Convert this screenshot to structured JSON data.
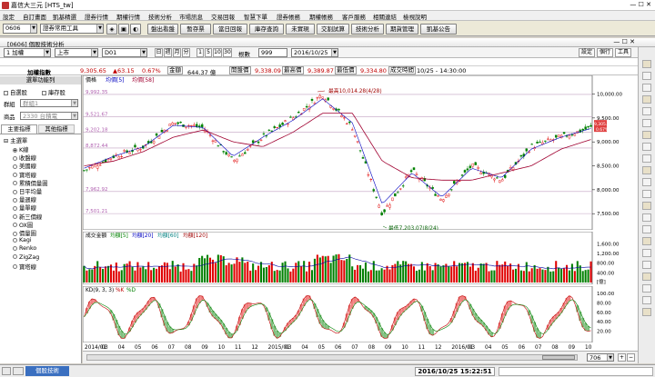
{
  "app": {
    "title": "嘉信大三元 [HTS_tw]"
  },
  "menu": [
    "設定",
    "自訂畫面",
    "凱基精選",
    "證券行情",
    "期權行情",
    "技術分析",
    "市場訊息",
    "交易回報",
    "智慧下單",
    "證券帳務",
    "期權帳務",
    "客戶服務",
    "相關連結",
    "檢視說明"
  ],
  "toolbar": {
    "code": "0606",
    "layout_select": "證券常用工具",
    "buttons": [
      "盤出看盤",
      "暫存票",
      "當日回報",
      "庫存查詢",
      "未實現",
      "交割試算",
      "技術分析",
      "期貨管理",
      "凱基公告"
    ]
  },
  "window": {
    "title": "[0606] 個股技術分析"
  },
  "controls": {
    "symbol": "1 加權",
    "market": "上市",
    "period": "D01",
    "freq_buttons": [
      "日",
      "週",
      "月",
      "分"
    ],
    "minute_buttons": [
      "1",
      "5",
      "10",
      "30"
    ],
    "count_label": "根數",
    "count": "999",
    "date": "2016/10/25",
    "right_buttons": [
      "設定",
      "個行",
      "工具"
    ]
  },
  "quote": {
    "name": "加權指數",
    "price": "9,305.65",
    "change": "▲63.15",
    "pct": "0.67%",
    "vol_label": "金額",
    "vol": "644.37 億",
    "open_label": "開盤價",
    "open": "9,338.09",
    "high_label": "最高價",
    "high": "9,389.87",
    "low_label": "最低價",
    "low": "9,334.80",
    "time_label": "成交時間",
    "time": "10/25 - 14:30:00"
  },
  "left": {
    "header": "選單功能列",
    "checks": [
      "自選股",
      "庫存股"
    ],
    "group_label": "群組",
    "group_value": "群組1",
    "product_label": "商品",
    "product_value": "2330 台積電",
    "tabs": [
      "主要指標",
      "其他指標"
    ],
    "tree_root": "主選單",
    "items": [
      "K線",
      "收盤線",
      "美國線",
      "寶塔線",
      "累積價量圖",
      "日平均量",
      "量週線",
      "量單線",
      "新三價線",
      "OX圖",
      "價量圖",
      "Kagi",
      "Renko",
      "ZigZag",
      "寶塔線"
    ]
  },
  "chart_labels": {
    "main_title": "價格",
    "ma5": "均價[5]",
    "ma58": "均價[58]",
    "high_ann": "最高10,014.28(4/28)",
    "low_ann": "最低7,203.07(8/24)",
    "vol_title": "成交金額",
    "vol_ma5": "均額[5]",
    "vol_ma20": "均額[20]",
    "vol_ma60": "均額[60]",
    "vol_ma120": "均額[120]",
    "vol_unit": "[億]",
    "kd_title": "KD(9, 3, 3)",
    "kd_k": "%K",
    "kd_d": "%D",
    "price_tag": "9,305.65",
    "pct_tag": "0.67%",
    "fib_levels": [
      "9,992.35",
      "9,521.67",
      "9,202.18",
      "8,872.44",
      "7,962.92",
      "7,501.21"
    ]
  },
  "chart_data": [
    {
      "type": "line",
      "title": "價格",
      "x": [
        "2014/01",
        "2014/03",
        "2014/05",
        "2014/07",
        "2014/09",
        "2014/11",
        "2015/01",
        "2015/03",
        "2015/05",
        "2015/07",
        "2015/09",
        "2015/11",
        "2016/01",
        "2016/03",
        "2016/05",
        "2016/07",
        "2016/09",
        "2016/10"
      ],
      "series": [
        {
          "name": "K線",
          "values": [
            8400,
            8700,
            8900,
            9400,
            9300,
            8600,
            9100,
            9500,
            10000,
            9300,
            7500,
            8400,
            7800,
            8500,
            8200,
            8900,
            9100,
            9300
          ]
        },
        {
          "name": "均價[5]",
          "values": [
            8450,
            8700,
            8900,
            9350,
            9300,
            8700,
            9100,
            9450,
            9900,
            9400,
            7700,
            8350,
            7850,
            8450,
            8250,
            8850,
            9100,
            9280
          ]
        },
        {
          "name": "均價[58]",
          "values": [
            8500,
            8600,
            8800,
            9100,
            9250,
            9000,
            8900,
            9200,
            9600,
            9600,
            8600,
            8250,
            8200,
            8200,
            8350,
            8500,
            8850,
            9050
          ]
        }
      ],
      "ylim": [
        7200,
        10200
      ],
      "yticks": [
        7500,
        8000,
        8500,
        9000,
        9500,
        10000
      ],
      "ytick_labels": [
        "7,500.00",
        "8,000.00",
        "8,500.00",
        "9,000.00",
        "9,500.00",
        "10,000.00"
      ]
    },
    {
      "type": "bar",
      "title": "成交金額",
      "ylim": [
        0,
        1800
      ],
      "yticks": [
        400,
        800,
        1200,
        1600
      ],
      "ytick_labels": [
        "400.00",
        "800.00",
        "1,200.00",
        "1,600.00"
      ]
    },
    {
      "type": "line",
      "title": "KD(9, 3, 3)",
      "ylim": [
        0,
        100
      ],
      "yticks": [
        20,
        40,
        60,
        80,
        100
      ],
      "ytick_labels": [
        "20.00",
        "40.00",
        "60.00",
        "80.00",
        "100.00"
      ]
    }
  ],
  "xaxis": {
    "labels": [
      "2014/01",
      "03",
      "04",
      "05",
      "06",
      "07",
      "08",
      "09",
      "10",
      "11",
      "12",
      "2015/01",
      "03",
      "04",
      "05",
      "06",
      "07",
      "08",
      "09",
      "10",
      "11",
      "12",
      "2016/01",
      "03",
      "04",
      "05",
      "06",
      "07",
      "08",
      "09",
      "10"
    ]
  },
  "status": {
    "tab": "個股技術",
    "datetime": "2016/10/25 15:22:51",
    "zoom": "706"
  },
  "colors": {
    "up": "#e00000",
    "down": "#008000",
    "ma5": "#0000c0",
    "ma58": "#a00030",
    "fib": "#c080c0"
  }
}
